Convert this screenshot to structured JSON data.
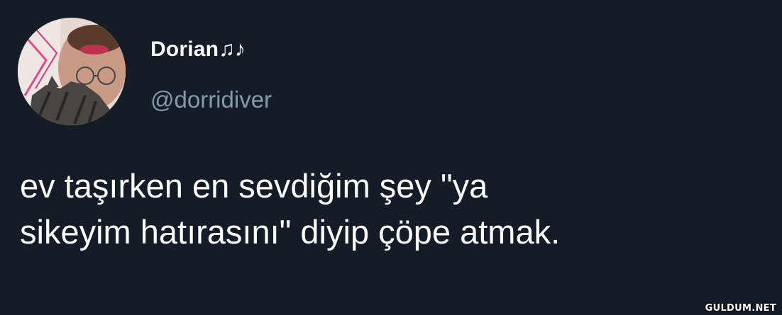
{
  "tweet": {
    "display_name": "Dorian♫♪",
    "handle": "@dorridiver",
    "text": "ev taşırken en sevdiğim şey \"ya\nsikeyim hatırasını\" diyip çöpe atmak."
  },
  "watermark": "GULDUM.NET",
  "colors": {
    "background": "#141c27",
    "name": "#ffffff",
    "handle": "#8899a6",
    "text": "#ffffff"
  },
  "icons": {
    "avatar": "profile-photo"
  }
}
